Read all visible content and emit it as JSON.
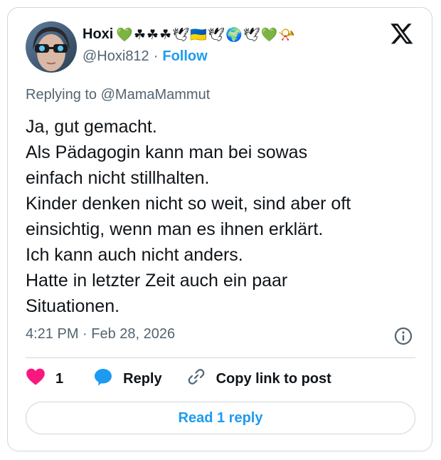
{
  "author": {
    "display_name": "Hoxi",
    "name_emojis": "💚☘☘☘🕊🇺🇦🕊🌍🕊💚📯",
    "handle": "@Hoxi812",
    "separator": "·",
    "follow_label": "Follow"
  },
  "tweet": {
    "replying_to": "Replying to @MamaMammut",
    "lines": [
      "Ja, gut gemacht.",
      "Als Pädagogin kann man bei sowas",
      "einfach nicht stillhalten.",
      "Kinder denken nicht so weit, sind aber oft",
      "einsichtig, wenn man es ihnen erklärt.",
      "Ich kann auch nicht anders.",
      "Hatte in letzter Zeit auch ein paar",
      "Situationen."
    ],
    "timestamp": "4:21 PM · Feb 28, 2026"
  },
  "actions": {
    "like_count": "1",
    "reply_label": "Reply",
    "copy_label": "Copy link to post"
  },
  "read_replies_label": "Read 1 reply",
  "colors": {
    "accent": "#1d9bf0",
    "like": "#f91880",
    "muted": "#536471",
    "border": "#cfd9de"
  },
  "icons": [
    "x-logo-icon",
    "info-icon",
    "heart-icon",
    "reply-bubble-icon",
    "link-icon"
  ]
}
